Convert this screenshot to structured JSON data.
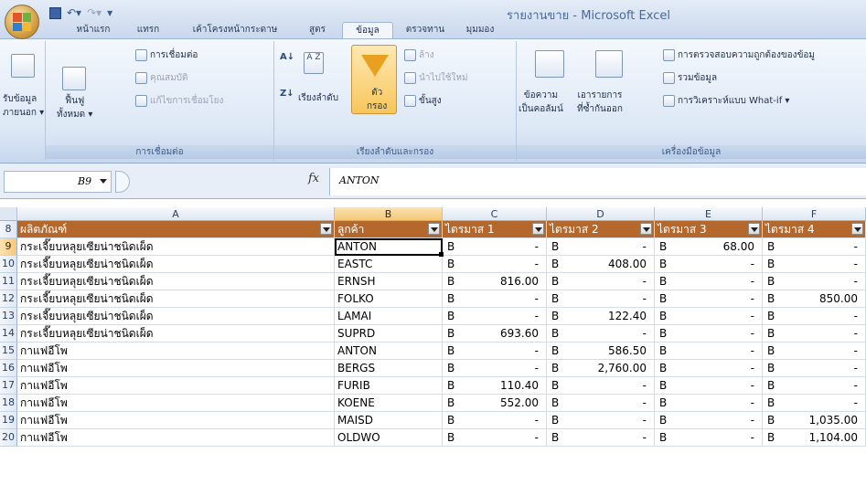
{
  "window": {
    "title": "รายงานขาย - Microsoft Excel"
  },
  "qat": {
    "save_icon": "save-icon",
    "undo_icon": "undo-icon",
    "redo_icon": "redo-icon",
    "customize_icon": "customize-qat-icon"
  },
  "tabs": [
    "หน้าแรก",
    "แทรก",
    "เค้าโครงหน้ากระดาษ",
    "สูตร",
    "ข้อมูล",
    "ตรวจทาน",
    "มุมมอง"
  ],
  "active_tab": "ข้อมูล",
  "ribbon": {
    "get_external": {
      "line1": "รับข้อมูล",
      "line2": "ภายนอก ▾"
    },
    "refresh": {
      "line1": "ฟื้นฟู",
      "line2": "ทั้งหมด ▾"
    },
    "connections": "การเชื่อมต่อ",
    "properties": "คุณสมบัติ",
    "edit_links": "แก้ไขการเชื่อมโยง",
    "group_connections": "การเชื่อมต่อ",
    "sort_az": "A Z",
    "sort": "เรียงลำดับ",
    "filter": {
      "line1": "ตัว",
      "line2": "กรอง"
    },
    "clear": "ล้าง",
    "reapply": "นำไปใช้ใหม่",
    "advanced": "ขั้นสูง",
    "group_sort": "เรียงลำดับและกรอง",
    "text_to_columns": {
      "line1": "ข้อความ",
      "line2": "เป็นคอลัมน์"
    },
    "remove_duplicates": {
      "line1": "เอารายการ",
      "line2": "ที่ซ้ำกันออก"
    },
    "data_validation": "การตรวจสอบความถูกต้องของข้อมู",
    "consolidate": "รวมข้อมูล",
    "whatif": "การวิเคราะห์แบบ What-if ▾",
    "group_tools": "เครื่องมือข้อมูล"
  },
  "formula_bar": {
    "name_box": "B9",
    "fx": "fx",
    "value": "ANTON"
  },
  "columns": [
    "A",
    "B",
    "C",
    "D",
    "E",
    "F"
  ],
  "header_row": {
    "row": "8",
    "cells": [
      "ผลิตภัณฑ์",
      "ลูกค้า",
      "ไตรมาส 1",
      "ไตรมาส 2",
      "ไตรมาส 3",
      "ไตรมาส 4"
    ]
  },
  "rows": [
    {
      "row": "9",
      "product": "กระเจี๊ยบหลุยเซียน่าชนิดเผ็ด",
      "customer": "ANTON",
      "q": [
        [
          "B",
          "-"
        ],
        [
          "B",
          "-"
        ],
        [
          "B",
          "68.00"
        ],
        [
          "B",
          "-"
        ]
      ]
    },
    {
      "row": "10",
      "product": "กระเจี๊ยบหลุยเซียน่าชนิดเผ็ด",
      "customer": "EASTC",
      "q": [
        [
          "B",
          "-"
        ],
        [
          "B",
          "408.00"
        ],
        [
          "B",
          "-"
        ],
        [
          "B",
          "-"
        ]
      ]
    },
    {
      "row": "11",
      "product": "กระเจี๊ยบหลุยเซียน่าชนิดเผ็ด",
      "customer": "ERNSH",
      "q": [
        [
          "B",
          "816.00"
        ],
        [
          "B",
          "-"
        ],
        [
          "B",
          "-"
        ],
        [
          "B",
          "-"
        ]
      ]
    },
    {
      "row": "12",
      "product": "กระเจี๊ยบหลุยเซียน่าชนิดเผ็ด",
      "customer": "FOLKO",
      "q": [
        [
          "B",
          "-"
        ],
        [
          "B",
          "-"
        ],
        [
          "B",
          "-"
        ],
        [
          "B",
          "850.00"
        ]
      ]
    },
    {
      "row": "13",
      "product": "กระเจี๊ยบหลุยเซียน่าชนิดเผ็ด",
      "customer": "LAMAI",
      "q": [
        [
          "B",
          "-"
        ],
        [
          "B",
          "122.40"
        ],
        [
          "B",
          "-"
        ],
        [
          "B",
          "-"
        ]
      ]
    },
    {
      "row": "14",
      "product": "กระเจี๊ยบหลุยเซียน่าชนิดเผ็ด",
      "customer": "SUPRD",
      "q": [
        [
          "B",
          "693.60"
        ],
        [
          "B",
          "-"
        ],
        [
          "B",
          "-"
        ],
        [
          "B",
          "-"
        ]
      ]
    },
    {
      "row": "15",
      "product": "กาแฟอีโพ",
      "customer": "ANTON",
      "q": [
        [
          "B",
          "-"
        ],
        [
          "B",
          "586.50"
        ],
        [
          "B",
          "-"
        ],
        [
          "B",
          "-"
        ]
      ]
    },
    {
      "row": "16",
      "product": "กาแฟอีโพ",
      "customer": "BERGS",
      "q": [
        [
          "B",
          "-"
        ],
        [
          "B",
          "2,760.00"
        ],
        [
          "B",
          "-"
        ],
        [
          "B",
          "-"
        ]
      ]
    },
    {
      "row": "17",
      "product": "กาแฟอีโพ",
      "customer": "FURIB",
      "q": [
        [
          "B",
          "110.40"
        ],
        [
          "B",
          "-"
        ],
        [
          "B",
          "-"
        ],
        [
          "B",
          "-"
        ]
      ]
    },
    {
      "row": "18",
      "product": "กาแฟอีโพ",
      "customer": "KOENE",
      "q": [
        [
          "B",
          "552.00"
        ],
        [
          "B",
          "-"
        ],
        [
          "B",
          "-"
        ],
        [
          "B",
          "-"
        ]
      ]
    },
    {
      "row": "19",
      "product": "กาแฟอีโพ",
      "customer": "MAISD",
      "q": [
        [
          "B",
          "-"
        ],
        [
          "B",
          "-"
        ],
        [
          "B",
          "-"
        ],
        [
          "B",
          "1,035.00"
        ]
      ]
    },
    {
      "row": "20",
      "product": "กาแฟอีโพ",
      "customer": "OLDWO",
      "q": [
        [
          "B",
          "-"
        ],
        [
          "B",
          "-"
        ],
        [
          "B",
          "-"
        ],
        [
          "B",
          "1,104.00"
        ]
      ]
    }
  ],
  "colors": {
    "header_fill": "#b5682c",
    "accent": "#f5c877"
  }
}
